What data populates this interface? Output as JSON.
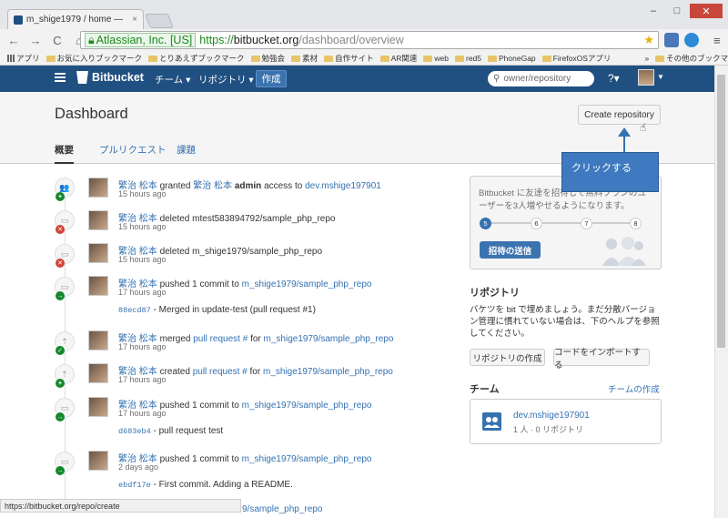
{
  "browser": {
    "tab_title": "m_shige1979 / home —",
    "tab_close": "×",
    "ev_badge": "Atlassian, Inc. [US]",
    "url_scheme": "https://",
    "url_host": "bitbucket.org",
    "url_path": "/dashboard/overview",
    "bookmarks": [
      "アプリ",
      "お気に入りブックマーク",
      "とりあえずブックマーク",
      "勉強会",
      "素材",
      "自作サイト",
      "AR関連",
      "web",
      "red5",
      "PhoneGap",
      "FirefoxOSアプリ"
    ],
    "bookmarks_more": "»",
    "bookmarks_other": "その他のブックマーク",
    "status_url": "https://bitbucket.org/repo/create"
  },
  "header": {
    "logo": "Bitbucket",
    "nav_team": "チーム ▾",
    "nav_repo": "リポジトリ ▾",
    "create": "作成",
    "search_placeholder": "owner/repository",
    "help": "?▾"
  },
  "page": {
    "title": "Dashboard",
    "create_repo": "Create repository",
    "tabs": [
      "概要",
      "プルリクエスト",
      "課題"
    ]
  },
  "annotation": {
    "callout": "クリックする"
  },
  "feed": [
    {
      "user": "繁治 松本",
      "pre": "granted",
      "user2": "繁治 松本",
      "bold": "admin",
      "mid": "access to",
      "link": "dev.mshige197901",
      "time": "15 hours ago"
    },
    {
      "user": "繁治 松本",
      "text": "deleted mtest583894792/sample_php_repo",
      "time": "15 hours ago"
    },
    {
      "user": "繁治 松本",
      "text": "deleted m_shige1979/sample_php_repo",
      "time": "15 hours ago"
    },
    {
      "user": "繁治 松本",
      "text": "pushed 1 commit to",
      "link": "m_shige1979/sample_php_repo",
      "time": "17 hours ago",
      "commit_hash": "88ecd87",
      "commit_msg": "- Merged in update-test (pull request #1)"
    },
    {
      "user": "繁治 松本",
      "text": "merged",
      "link_pr": "pull request #",
      "mid": "for",
      "link": "m_shige1979/sample_php_repo",
      "time": "17 hours ago"
    },
    {
      "user": "繁治 松本",
      "text": "created",
      "link_pr": "pull request #",
      "mid": "for",
      "link": "m_shige1979/sample_php_repo",
      "time": "17 hours ago"
    },
    {
      "user": "繁治 松本",
      "text": "pushed 1 commit to",
      "link": "m_shige1979/sample_php_repo",
      "time": "17 hours ago",
      "commit_hash": "d683eb4",
      "commit_msg": "- pull request test"
    },
    {
      "user": "繁治 松本",
      "text": "pushed 1 commit to",
      "link": "m_shige1979/sample_php_repo",
      "time": "2 days ago",
      "commit_hash": "ebdf17e",
      "commit_msg": "- First commit. Adding a README."
    },
    {
      "link": "9/sample_php_repo"
    }
  ],
  "sidebar": {
    "invite_text": "Bitbucket に友達を招待して無料プランのユーザーを3人増やせるようになります。",
    "steps": [
      "5",
      "6",
      "7",
      "8"
    ],
    "invite_button": "招待の送信",
    "repo_title": "リポジトリ",
    "repo_text": "バケツを bit で埋めましょう。まだ分散バージョン管理に慣れていない場合は、下のヘルプを参照してください。",
    "repo_create": "リポジトリの作成",
    "repo_import": "コードをインポートする",
    "team_title": "チーム",
    "team_create": "チームの作成",
    "team_name": "dev.mshige197901",
    "team_meta": "1 人 · 0 リポジトリ"
  },
  "colors": {
    "header_bg": "#205081",
    "link": "#3572b0",
    "callout": "#3f79bf"
  }
}
